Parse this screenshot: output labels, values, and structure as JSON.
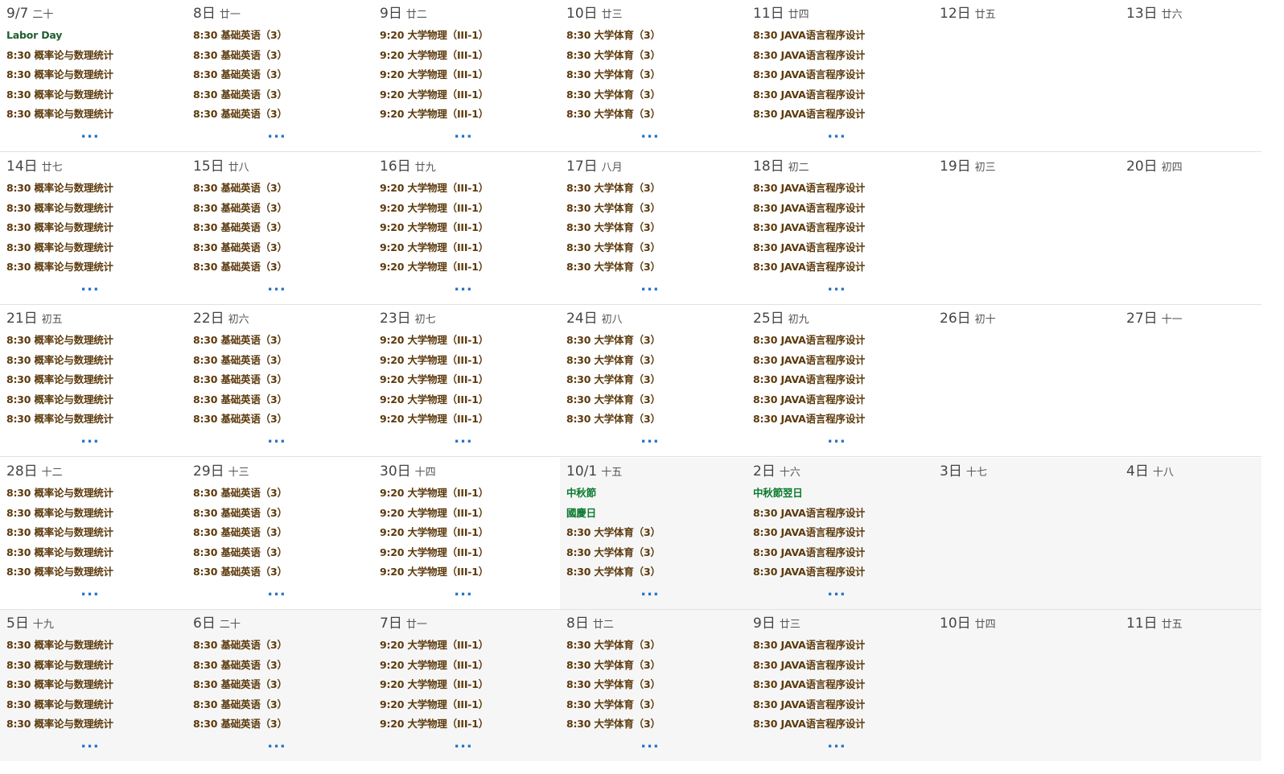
{
  "colors": {
    "course": "#5c3a0c",
    "holiday": "#0a7a2f",
    "more": "#2773c4",
    "other_month_bg": "#f6f6f6",
    "divider": "#e1e1e1"
  },
  "more_label": "...",
  "weeks": [
    {
      "days": [
        {
          "num": "9/7",
          "lunar": "二十",
          "other_month": false,
          "events": [
            {
              "text": "Labor Day",
              "kind": "holiday-en"
            },
            {
              "text": "8:30 概率论与数理统计",
              "kind": "course"
            },
            {
              "text": "8:30 概率论与数理统计",
              "kind": "course"
            },
            {
              "text": "8:30 概率论与数理统计",
              "kind": "course"
            },
            {
              "text": "8:30 概率论与数理统计",
              "kind": "course"
            }
          ],
          "more": true
        },
        {
          "num": "8日",
          "lunar": "廿一",
          "other_month": false,
          "events": [
            {
              "text": "8:30 基础英语（3）",
              "kind": "course"
            },
            {
              "text": "8:30 基础英语（3）",
              "kind": "course"
            },
            {
              "text": "8:30 基础英语（3）",
              "kind": "course"
            },
            {
              "text": "8:30 基础英语（3）",
              "kind": "course"
            },
            {
              "text": "8:30 基础英语（3）",
              "kind": "course"
            }
          ],
          "more": true
        },
        {
          "num": "9日",
          "lunar": "廿二",
          "other_month": false,
          "events": [
            {
              "text": "9:20 大学物理（III-1）",
              "kind": "course"
            },
            {
              "text": "9:20 大学物理（III-1）",
              "kind": "course"
            },
            {
              "text": "9:20 大学物理（III-1）",
              "kind": "course"
            },
            {
              "text": "9:20 大学物理（III-1）",
              "kind": "course"
            },
            {
              "text": "9:20 大学物理（III-1）",
              "kind": "course"
            }
          ],
          "more": true
        },
        {
          "num": "10日",
          "lunar": "廿三",
          "other_month": false,
          "events": [
            {
              "text": "8:30 大学体育（3）",
              "kind": "course"
            },
            {
              "text": "8:30 大学体育（3）",
              "kind": "course"
            },
            {
              "text": "8:30 大学体育（3）",
              "kind": "course"
            },
            {
              "text": "8:30 大学体育（3）",
              "kind": "course"
            },
            {
              "text": "8:30 大学体育（3）",
              "kind": "course"
            }
          ],
          "more": true
        },
        {
          "num": "11日",
          "lunar": "廿四",
          "other_month": false,
          "events": [
            {
              "text": "8:30 JAVA语言程序设计",
              "kind": "course"
            },
            {
              "text": "8:30 JAVA语言程序设计",
              "kind": "course"
            },
            {
              "text": "8:30 JAVA语言程序设计",
              "kind": "course"
            },
            {
              "text": "8:30 JAVA语言程序设计",
              "kind": "course"
            },
            {
              "text": "8:30 JAVA语言程序设计",
              "kind": "course"
            }
          ],
          "more": true
        },
        {
          "num": "12日",
          "lunar": "廿五",
          "other_month": false,
          "events": [],
          "more": false
        },
        {
          "num": "13日",
          "lunar": "廿六",
          "other_month": false,
          "events": [],
          "more": false
        }
      ]
    },
    {
      "days": [
        {
          "num": "14日",
          "lunar": "廿七",
          "other_month": false,
          "events": [
            {
              "text": "8:30 概率论与数理统计",
              "kind": "course"
            },
            {
              "text": "8:30 概率论与数理统计",
              "kind": "course"
            },
            {
              "text": "8:30 概率论与数理统计",
              "kind": "course"
            },
            {
              "text": "8:30 概率论与数理统计",
              "kind": "course"
            },
            {
              "text": "8:30 概率论与数理统计",
              "kind": "course"
            }
          ],
          "more": true
        },
        {
          "num": "15日",
          "lunar": "廿八",
          "other_month": false,
          "events": [
            {
              "text": "8:30 基础英语（3）",
              "kind": "course"
            },
            {
              "text": "8:30 基础英语（3）",
              "kind": "course"
            },
            {
              "text": "8:30 基础英语（3）",
              "kind": "course"
            },
            {
              "text": "8:30 基础英语（3）",
              "kind": "course"
            },
            {
              "text": "8:30 基础英语（3）",
              "kind": "course"
            }
          ],
          "more": true
        },
        {
          "num": "16日",
          "lunar": "廿九",
          "other_month": false,
          "events": [
            {
              "text": "9:20 大学物理（III-1）",
              "kind": "course"
            },
            {
              "text": "9:20 大学物理（III-1）",
              "kind": "course"
            },
            {
              "text": "9:20 大学物理（III-1）",
              "kind": "course"
            },
            {
              "text": "9:20 大学物理（III-1）",
              "kind": "course"
            },
            {
              "text": "9:20 大学物理（III-1）",
              "kind": "course"
            }
          ],
          "more": true
        },
        {
          "num": "17日",
          "lunar": "八月",
          "other_month": false,
          "events": [
            {
              "text": "8:30 大学体育（3）",
              "kind": "course"
            },
            {
              "text": "8:30 大学体育（3）",
              "kind": "course"
            },
            {
              "text": "8:30 大学体育（3）",
              "kind": "course"
            },
            {
              "text": "8:30 大学体育（3）",
              "kind": "course"
            },
            {
              "text": "8:30 大学体育（3）",
              "kind": "course"
            }
          ],
          "more": true
        },
        {
          "num": "18日",
          "lunar": "初二",
          "other_month": false,
          "events": [
            {
              "text": "8:30 JAVA语言程序设计",
              "kind": "course"
            },
            {
              "text": "8:30 JAVA语言程序设计",
              "kind": "course"
            },
            {
              "text": "8:30 JAVA语言程序设计",
              "kind": "course"
            },
            {
              "text": "8:30 JAVA语言程序设计",
              "kind": "course"
            },
            {
              "text": "8:30 JAVA语言程序设计",
              "kind": "course"
            }
          ],
          "more": true
        },
        {
          "num": "19日",
          "lunar": "初三",
          "other_month": false,
          "events": [],
          "more": false
        },
        {
          "num": "20日",
          "lunar": "初四",
          "other_month": false,
          "events": [],
          "more": false
        }
      ]
    },
    {
      "days": [
        {
          "num": "21日",
          "lunar": "初五",
          "other_month": false,
          "events": [
            {
              "text": "8:30 概率论与数理统计",
              "kind": "course"
            },
            {
              "text": "8:30 概率论与数理统计",
              "kind": "course"
            },
            {
              "text": "8:30 概率论与数理统计",
              "kind": "course"
            },
            {
              "text": "8:30 概率论与数理统计",
              "kind": "course"
            },
            {
              "text": "8:30 概率论与数理统计",
              "kind": "course"
            }
          ],
          "more": true
        },
        {
          "num": "22日",
          "lunar": "初六",
          "other_month": false,
          "events": [
            {
              "text": "8:30 基础英语（3）",
              "kind": "course"
            },
            {
              "text": "8:30 基础英语（3）",
              "kind": "course"
            },
            {
              "text": "8:30 基础英语（3）",
              "kind": "course"
            },
            {
              "text": "8:30 基础英语（3）",
              "kind": "course"
            },
            {
              "text": "8:30 基础英语（3）",
              "kind": "course"
            }
          ],
          "more": true
        },
        {
          "num": "23日",
          "lunar": "初七",
          "other_month": false,
          "events": [
            {
              "text": "9:20 大学物理（III-1）",
              "kind": "course"
            },
            {
              "text": "9:20 大学物理（III-1）",
              "kind": "course"
            },
            {
              "text": "9:20 大学物理（III-1）",
              "kind": "course"
            },
            {
              "text": "9:20 大学物理（III-1）",
              "kind": "course"
            },
            {
              "text": "9:20 大学物理（III-1）",
              "kind": "course"
            }
          ],
          "more": true
        },
        {
          "num": "24日",
          "lunar": "初八",
          "other_month": false,
          "events": [
            {
              "text": "8:30 大学体育（3）",
              "kind": "course"
            },
            {
              "text": "8:30 大学体育（3）",
              "kind": "course"
            },
            {
              "text": "8:30 大学体育（3）",
              "kind": "course"
            },
            {
              "text": "8:30 大学体育（3）",
              "kind": "course"
            },
            {
              "text": "8:30 大学体育（3）",
              "kind": "course"
            }
          ],
          "more": true
        },
        {
          "num": "25日",
          "lunar": "初九",
          "other_month": false,
          "events": [
            {
              "text": "8:30 JAVA语言程序设计",
              "kind": "course"
            },
            {
              "text": "8:30 JAVA语言程序设计",
              "kind": "course"
            },
            {
              "text": "8:30 JAVA语言程序设计",
              "kind": "course"
            },
            {
              "text": "8:30 JAVA语言程序设计",
              "kind": "course"
            },
            {
              "text": "8:30 JAVA语言程序设计",
              "kind": "course"
            }
          ],
          "more": true
        },
        {
          "num": "26日",
          "lunar": "初十",
          "other_month": false,
          "events": [],
          "more": false
        },
        {
          "num": "27日",
          "lunar": "十一",
          "other_month": false,
          "events": [],
          "more": false
        }
      ]
    },
    {
      "days": [
        {
          "num": "28日",
          "lunar": "十二",
          "other_month": false,
          "events": [
            {
              "text": "8:30 概率论与数理统计",
              "kind": "course"
            },
            {
              "text": "8:30 概率论与数理统计",
              "kind": "course"
            },
            {
              "text": "8:30 概率论与数理统计",
              "kind": "course"
            },
            {
              "text": "8:30 概率论与数理统计",
              "kind": "course"
            },
            {
              "text": "8:30 概率论与数理统计",
              "kind": "course"
            }
          ],
          "more": true
        },
        {
          "num": "29日",
          "lunar": "十三",
          "other_month": false,
          "events": [
            {
              "text": "8:30 基础英语（3）",
              "kind": "course"
            },
            {
              "text": "8:30 基础英语（3）",
              "kind": "course"
            },
            {
              "text": "8:30 基础英语（3）",
              "kind": "course"
            },
            {
              "text": "8:30 基础英语（3）",
              "kind": "course"
            },
            {
              "text": "8:30 基础英语（3）",
              "kind": "course"
            }
          ],
          "more": true
        },
        {
          "num": "30日",
          "lunar": "十四",
          "other_month": false,
          "events": [
            {
              "text": "9:20 大学物理（III-1）",
              "kind": "course"
            },
            {
              "text": "9:20 大学物理（III-1）",
              "kind": "course"
            },
            {
              "text": "9:20 大学物理（III-1）",
              "kind": "course"
            },
            {
              "text": "9:20 大学物理（III-1）",
              "kind": "course"
            },
            {
              "text": "9:20 大学物理（III-1）",
              "kind": "course"
            }
          ],
          "more": true
        },
        {
          "num": "10/1",
          "lunar": "十五",
          "other_month": true,
          "events": [
            {
              "text": "中秋節",
              "kind": "holiday"
            },
            {
              "text": "國慶日",
              "kind": "holiday"
            },
            {
              "text": "8:30 大学体育（3）",
              "kind": "course"
            },
            {
              "text": "8:30 大学体育（3）",
              "kind": "course"
            },
            {
              "text": "8:30 大学体育（3）",
              "kind": "course"
            }
          ],
          "more": true
        },
        {
          "num": "2日",
          "lunar": "十六",
          "other_month": true,
          "events": [
            {
              "text": "中秋節翌日",
              "kind": "holiday"
            },
            {
              "text": "8:30 JAVA语言程序设计",
              "kind": "course"
            },
            {
              "text": "8:30 JAVA语言程序设计",
              "kind": "course"
            },
            {
              "text": "8:30 JAVA语言程序设计",
              "kind": "course"
            },
            {
              "text": "8:30 JAVA语言程序设计",
              "kind": "course"
            }
          ],
          "more": true
        },
        {
          "num": "3日",
          "lunar": "十七",
          "other_month": true,
          "events": [],
          "more": false
        },
        {
          "num": "4日",
          "lunar": "十八",
          "other_month": true,
          "events": [],
          "more": false
        }
      ]
    },
    {
      "days": [
        {
          "num": "5日",
          "lunar": "十九",
          "other_month": true,
          "events": [
            {
              "text": "8:30 概率论与数理统计",
              "kind": "course"
            },
            {
              "text": "8:30 概率论与数理统计",
              "kind": "course"
            },
            {
              "text": "8:30 概率论与数理统计",
              "kind": "course"
            },
            {
              "text": "8:30 概率论与数理统计",
              "kind": "course"
            },
            {
              "text": "8:30 概率论与数理统计",
              "kind": "course"
            }
          ],
          "more": true
        },
        {
          "num": "6日",
          "lunar": "二十",
          "other_month": true,
          "events": [
            {
              "text": "8:30 基础英语（3）",
              "kind": "course"
            },
            {
              "text": "8:30 基础英语（3）",
              "kind": "course"
            },
            {
              "text": "8:30 基础英语（3）",
              "kind": "course"
            },
            {
              "text": "8:30 基础英语（3）",
              "kind": "course"
            },
            {
              "text": "8:30 基础英语（3）",
              "kind": "course"
            }
          ],
          "more": true
        },
        {
          "num": "7日",
          "lunar": "廿一",
          "other_month": true,
          "events": [
            {
              "text": "9:20 大学物理（III-1）",
              "kind": "course"
            },
            {
              "text": "9:20 大学物理（III-1）",
              "kind": "course"
            },
            {
              "text": "9:20 大学物理（III-1）",
              "kind": "course"
            },
            {
              "text": "9:20 大学物理（III-1）",
              "kind": "course"
            },
            {
              "text": "9:20 大学物理（III-1）",
              "kind": "course"
            }
          ],
          "more": true
        },
        {
          "num": "8日",
          "lunar": "廿二",
          "other_month": true,
          "events": [
            {
              "text": "8:30 大学体育（3）",
              "kind": "course"
            },
            {
              "text": "8:30 大学体育（3）",
              "kind": "course"
            },
            {
              "text": "8:30 大学体育（3）",
              "kind": "course"
            },
            {
              "text": "8:30 大学体育（3）",
              "kind": "course"
            },
            {
              "text": "8:30 大学体育（3）",
              "kind": "course"
            }
          ],
          "more": true
        },
        {
          "num": "9日",
          "lunar": "廿三",
          "other_month": true,
          "events": [
            {
              "text": "8:30 JAVA语言程序设计",
              "kind": "course"
            },
            {
              "text": "8:30 JAVA语言程序设计",
              "kind": "course"
            },
            {
              "text": "8:30 JAVA语言程序设计",
              "kind": "course"
            },
            {
              "text": "8:30 JAVA语言程序设计",
              "kind": "course"
            },
            {
              "text": "8:30 JAVA语言程序设计",
              "kind": "course"
            }
          ],
          "more": true
        },
        {
          "num": "10日",
          "lunar": "廿四",
          "other_month": true,
          "events": [],
          "more": false
        },
        {
          "num": "11日",
          "lunar": "廿五",
          "other_month": true,
          "events": [],
          "more": false
        }
      ]
    }
  ]
}
